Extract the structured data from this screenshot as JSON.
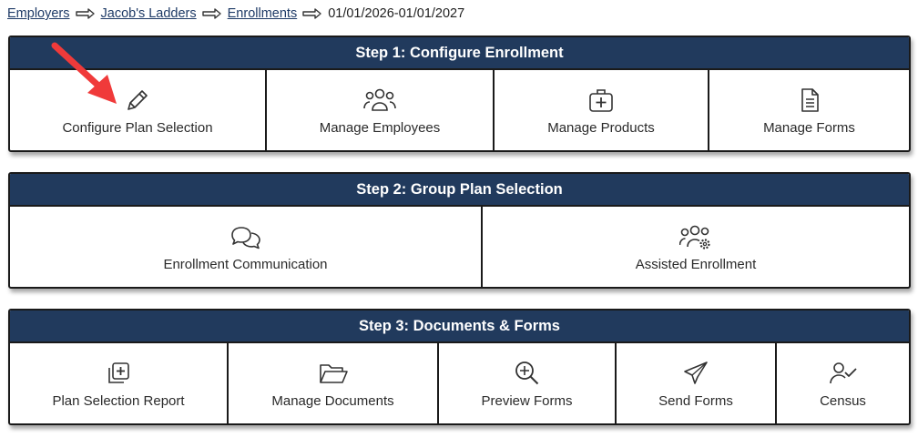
{
  "breadcrumb": {
    "items": [
      "Employers",
      "Jacob's Ladders",
      "Enrollments"
    ],
    "current": "01/01/2026-01/01/2027"
  },
  "step1": {
    "title": "Step 1: Configure Enrollment",
    "tiles": [
      {
        "label": "Configure Plan Selection",
        "icon": "pencil-icon"
      },
      {
        "label": "Manage Employees",
        "icon": "people-group-icon"
      },
      {
        "label": "Manage Products",
        "icon": "medical-kit-icon"
      },
      {
        "label": "Manage Forms",
        "icon": "document-icon"
      }
    ]
  },
  "step2": {
    "title": "Step 2: Group Plan Selection",
    "tiles": [
      {
        "label": "Enrollment Communication",
        "icon": "chat-bubbles-icon"
      },
      {
        "label": "Assisted Enrollment",
        "icon": "people-gear-icon"
      }
    ]
  },
  "step3": {
    "title": "Step 3: Documents & Forms",
    "tiles": [
      {
        "label": "Plan Selection Report",
        "icon": "add-copy-icon"
      },
      {
        "label": "Manage Documents",
        "icon": "folder-open-icon"
      },
      {
        "label": "Preview Forms",
        "icon": "zoom-in-icon"
      },
      {
        "label": "Send Forms",
        "icon": "paper-plane-icon"
      },
      {
        "label": "Census",
        "icon": "user-check-icon"
      }
    ]
  },
  "colors": {
    "header": "#213a5d",
    "link": "#1e3a66",
    "annotation_arrow": "#f03a3a"
  }
}
